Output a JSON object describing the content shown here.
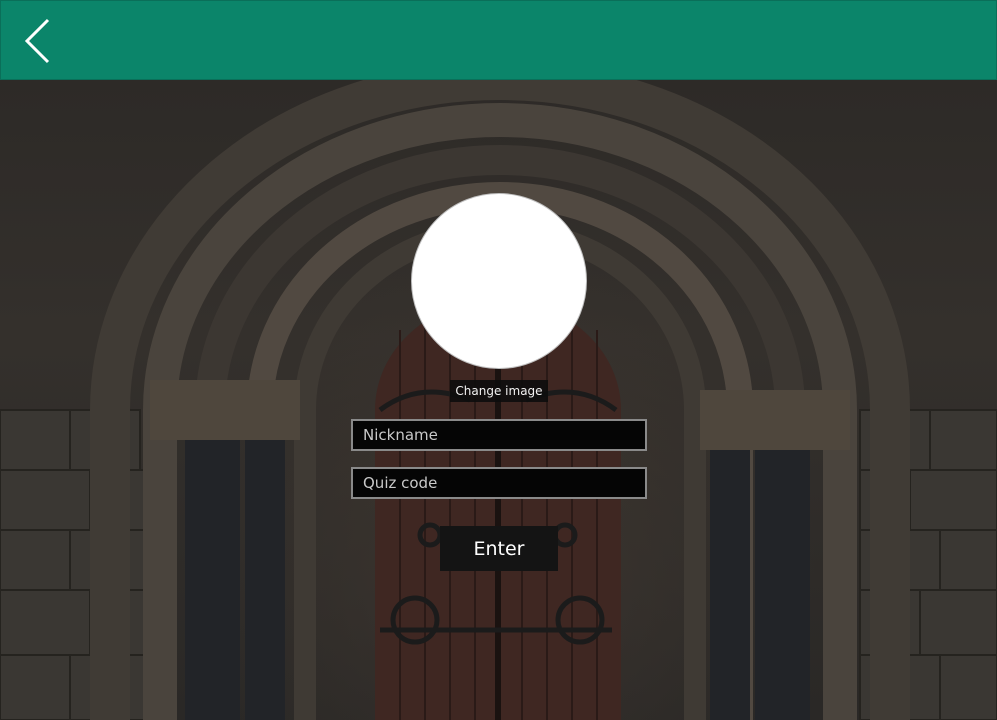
{
  "app_bar": {
    "color": "#0b856a",
    "back_icon": "chevron-left-icon"
  },
  "background": {
    "description_icon": "church-door-background",
    "overlay_color": "#000000"
  },
  "profile": {
    "change_image_label": "Change image"
  },
  "form": {
    "nickname_placeholder": "Nickname",
    "quiz_code_placeholder": "Quiz code",
    "enter_label": "Enter"
  }
}
